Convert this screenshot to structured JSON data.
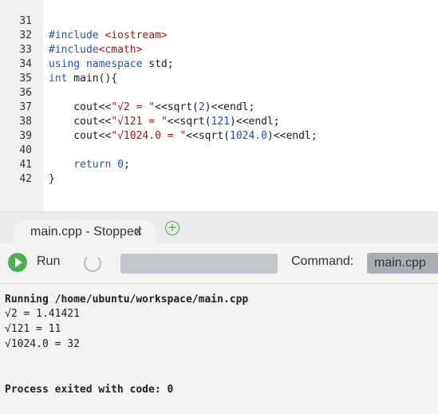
{
  "editor": {
    "lines": [
      {
        "n": "31"
      },
      {
        "n": "32"
      },
      {
        "n": "33"
      },
      {
        "n": "34"
      },
      {
        "n": "35"
      },
      {
        "n": "36"
      },
      {
        "n": "37"
      },
      {
        "n": "38"
      },
      {
        "n": "39"
      },
      {
        "n": "40"
      },
      {
        "n": "41"
      },
      {
        "n": "42"
      }
    ],
    "code": {
      "l31_a": "#include ",
      "l31_b": "<iostream>",
      "l32_a": "#include",
      "l32_b": "<cmath>",
      "l33_a": "using",
      "l33_b": " namespace",
      "l33_c": " std;",
      "l34_a": "int",
      "l34_b": " main(){",
      "l36_a": "    cout<<",
      "l36_b": "\"√2 = \"",
      "l36_c": "<<sqrt(",
      "l36_d": "2",
      "l36_e": ")<<endl;",
      "l37_a": "    cout<<",
      "l37_b": "\"√121 = \"",
      "l37_c": "<<sqrt(",
      "l37_d": "121",
      "l37_e": ")<<endl;",
      "l38_a": "    cout<<",
      "l38_b": "\"√1024.0 = \"",
      "l38_c": "<<sqrt(",
      "l38_d": "1024.0",
      "l38_e": ")<<endl;",
      "l40_a": "    return",
      "l40_b": " 0",
      "l40_c": ";",
      "l41_a": "}"
    }
  },
  "tabs": {
    "active_label": "main.cpp - Stopped",
    "close_glyph": "×",
    "add_glyph": "+"
  },
  "toolbar": {
    "run_label": "Run",
    "command_label": "Command:",
    "command_value": "main.cpp"
  },
  "console": {
    "lines": [
      "Running /home/ubuntu/workspace/main.cpp",
      "√2 = 1.41421",
      "√121 = 11",
      "√1024.0 = 32",
      "Process exited with code: 0"
    ]
  }
}
